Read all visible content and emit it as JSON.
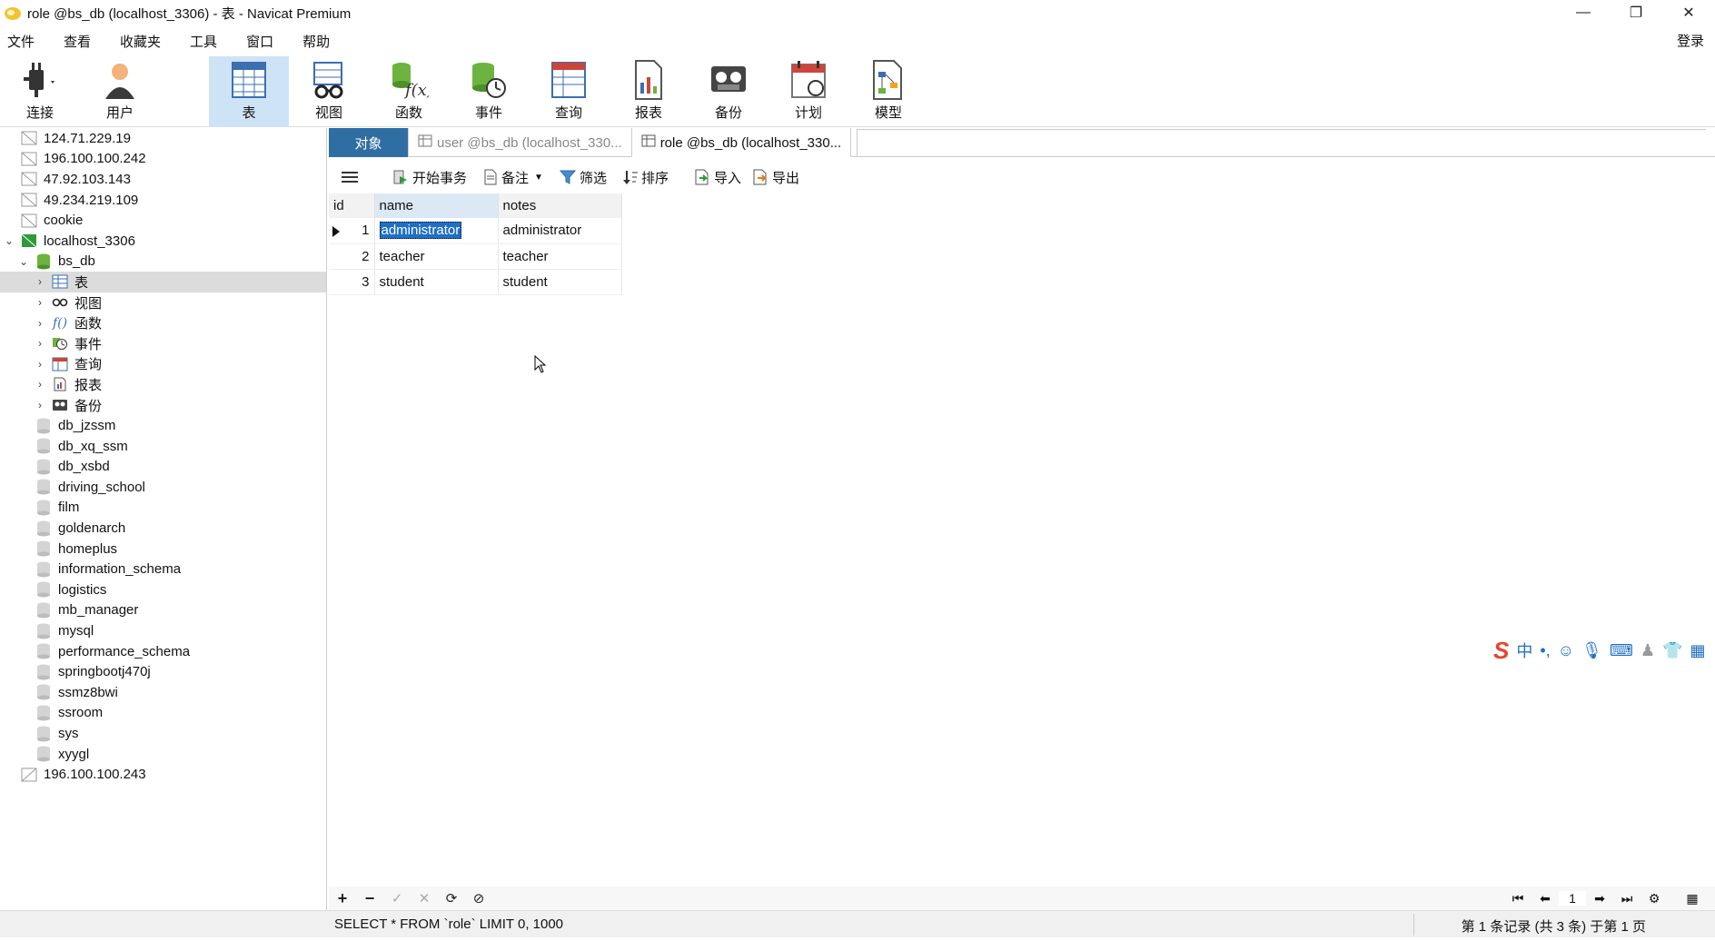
{
  "window": {
    "title": "role @bs_db (localhost_3306) - 表 - Navicat Premium",
    "minimize": "—",
    "restore": "❐",
    "close": "✕"
  },
  "menu": {
    "items": [
      "文件",
      "查看",
      "收藏夹",
      "工具",
      "窗口",
      "帮助"
    ],
    "login": "登录"
  },
  "toolbar": {
    "connect": "连接",
    "user": "用户",
    "table": "表",
    "view": "视图",
    "function": "函数",
    "event": "事件",
    "query": "查询",
    "report": "报表",
    "backup": "备份",
    "schedule": "计划",
    "model": "模型"
  },
  "tree": {
    "connections_top": [
      "124.71.229.19",
      "196.100.100.242",
      "47.92.103.143",
      "49.234.219.109",
      "cookie"
    ],
    "localhost": "localhost_3306",
    "bs_db": "bs_db",
    "bs_db_children": [
      "表",
      "视图",
      "函数",
      "事件",
      "查询",
      "报表",
      "备份"
    ],
    "databases": [
      "db_jzssm",
      "db_xq_ssm",
      "db_xsbd",
      "driving_school",
      "film",
      "goldenarch",
      "homeplus",
      "information_schema",
      "logistics",
      "mb_manager",
      "mysql",
      "performance_schema",
      "springbootj470j",
      "ssmz8bwi",
      "ssroom",
      "sys",
      "xyygl"
    ],
    "connection_bottom": "196.100.100.243"
  },
  "tabs": {
    "objects": "对象",
    "user_tab": "user @bs_db (localhost_330...",
    "role_tab": "role @bs_db (localhost_330..."
  },
  "data_toolbar": {
    "begin_transaction": "开始事务",
    "memo": "备注",
    "filter": "筛选",
    "sort": "排序",
    "import": "导入",
    "export": "导出"
  },
  "grid": {
    "columns": [
      "id",
      "name",
      "notes"
    ],
    "rows": [
      {
        "id": "1",
        "name": "administrator",
        "notes": "administrator"
      },
      {
        "id": "2",
        "name": "teacher",
        "notes": "teacher"
      },
      {
        "id": "3",
        "name": "student",
        "notes": "student"
      }
    ]
  },
  "bottom_nav": {
    "add": "+",
    "remove": "−",
    "apply": "✓",
    "discard": "✕",
    "refresh": "⟳",
    "stop": "⊘",
    "page": "1"
  },
  "status": {
    "sql": "SELECT * FROM `role` LIMIT 0, 1000",
    "records": "第 1 条记录 (共 3 条) 于第 1 页"
  },
  "colors": {
    "accent": "#1f6fc5",
    "object_tab": "#2f6ea3",
    "active_tool": "#cfe3f7"
  }
}
